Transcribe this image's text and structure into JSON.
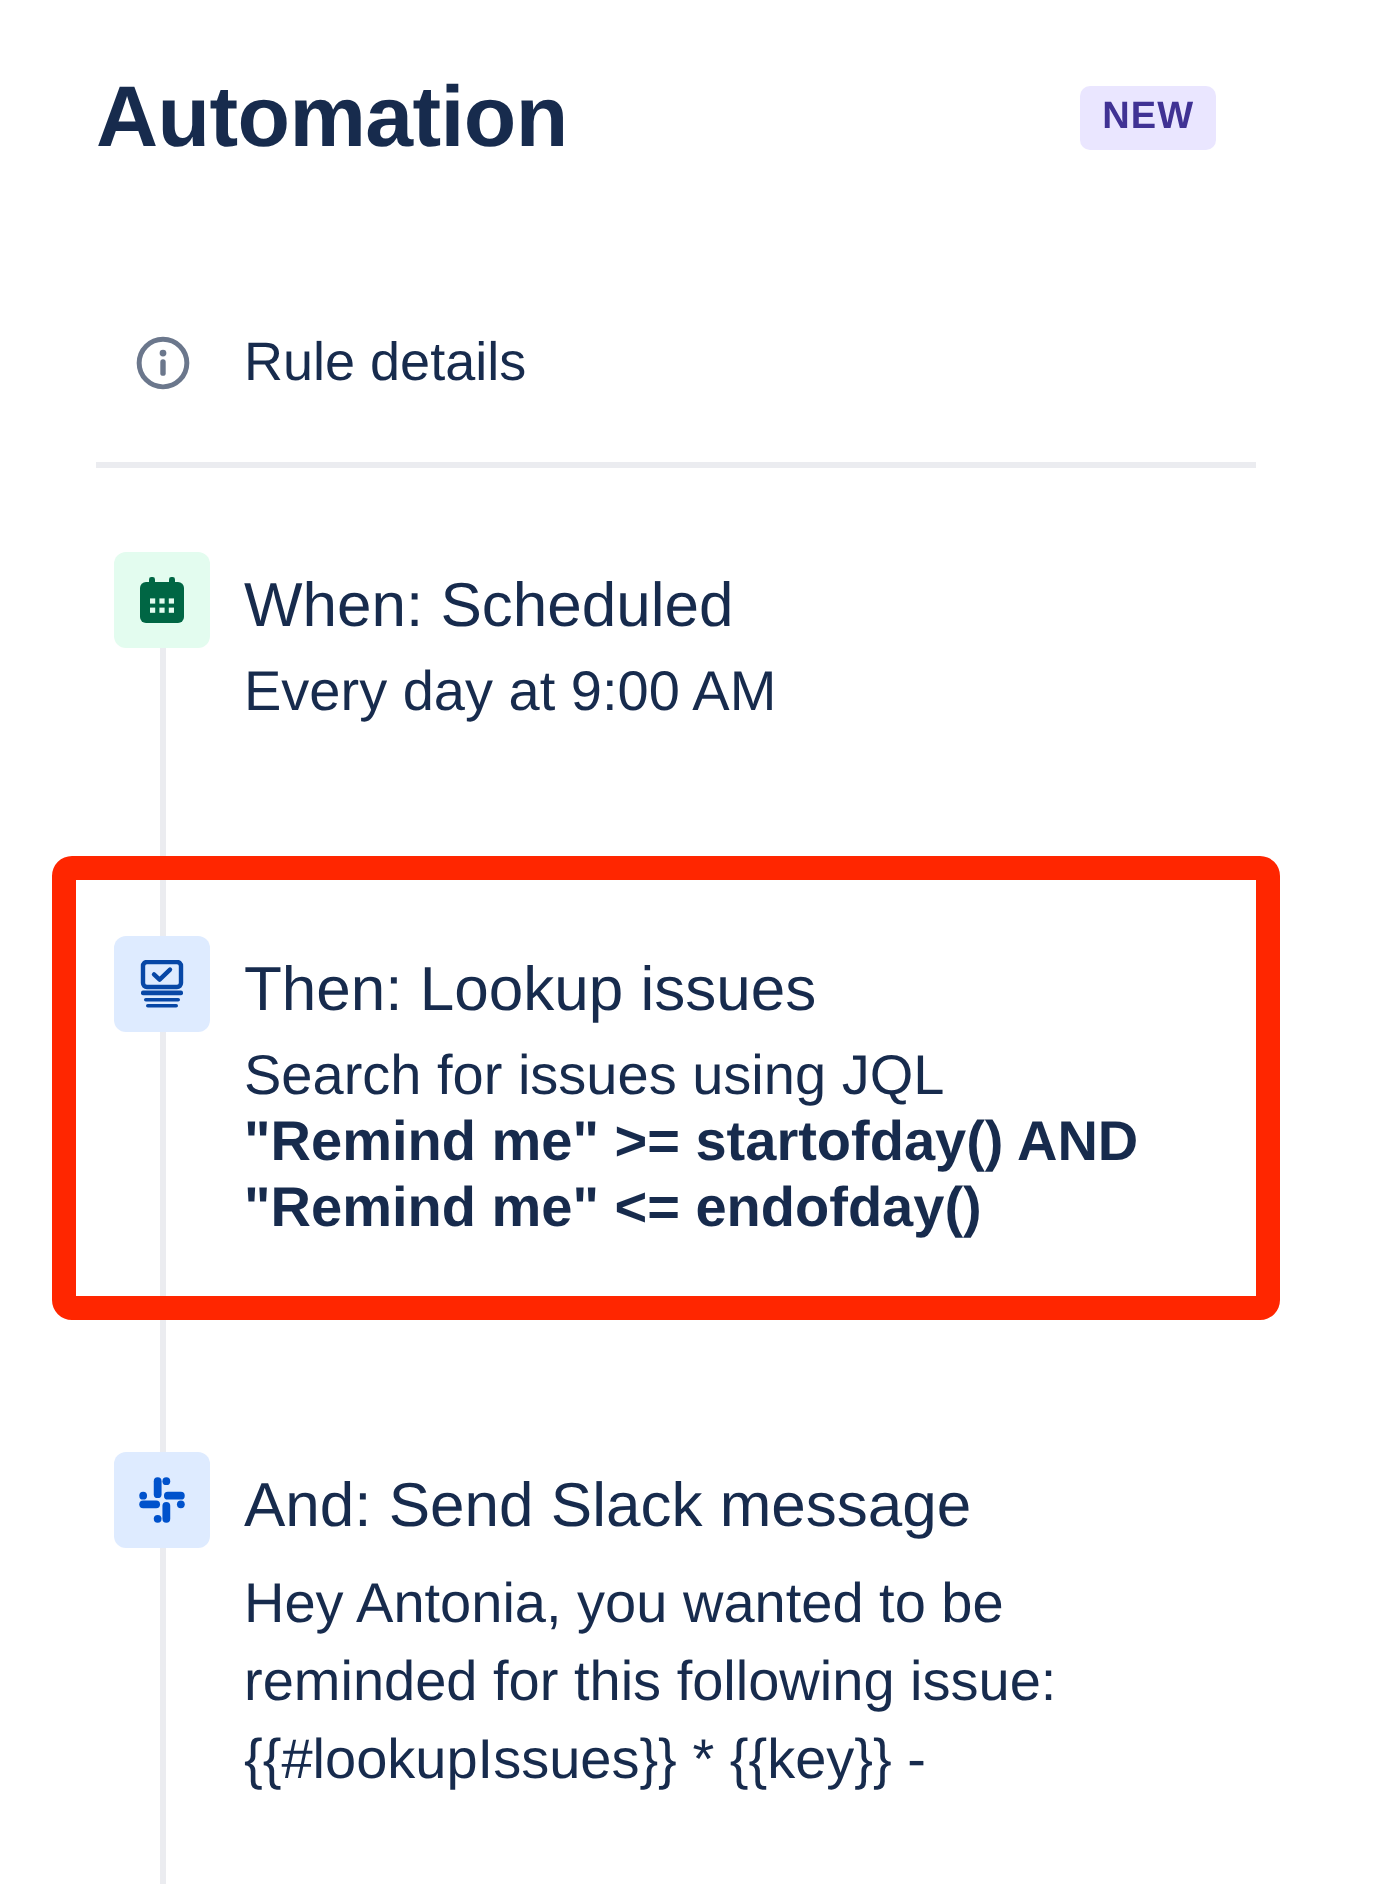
{
  "header": {
    "title": "Automation",
    "badge": "NEW"
  },
  "rule_details": {
    "label": "Rule details"
  },
  "steps": [
    {
      "kind": "scheduled",
      "title": "When: Scheduled",
      "description": "Every day at 9:00 AM",
      "highlighted": false
    },
    {
      "kind": "lookup",
      "title": "Then: Lookup issues",
      "description": "Search for issues using JQL",
      "query": "\"Remind me\" >= startofday() AND \"Remind me\" <= endofday()",
      "highlighted": true
    },
    {
      "kind": "slack",
      "title": "And: Send Slack message",
      "message": "Hey Antonia, you wanted to be reminded for this following issue: {{#lookupIssues}} * {{key}} -",
      "highlighted": false
    }
  ]
}
